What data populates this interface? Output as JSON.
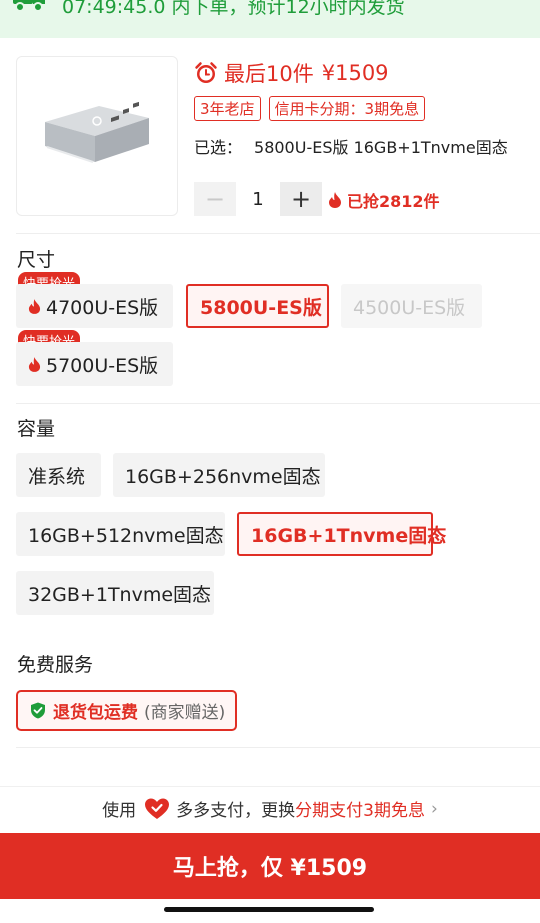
{
  "banner": {
    "text": "07:49:45.0 内下单，预计12小时内发货",
    "icon": "delivery-truck-icon",
    "color": "#1f9d3a"
  },
  "product": {
    "image": "mini-pc-product-image",
    "stock_text": "最后10件",
    "price": "¥1509",
    "tags": [
      "3年老店",
      "信用卡分期：3期免息"
    ],
    "selected_label": "已选：",
    "selected_value": "5800U-ES版 16GB+1Tnvme固态",
    "quantity": "1",
    "minus": "−",
    "plus": "+",
    "grabbed": "已抢2812件"
  },
  "size": {
    "title": "尺寸",
    "hot_badge": "快要抢光",
    "options": [
      {
        "label": "4700U-ES版",
        "state": "hot"
      },
      {
        "label": "5800U-ES版",
        "state": "selected"
      },
      {
        "label": "4500U-ES版",
        "state": "disabled"
      },
      {
        "label": "5700U-ES版",
        "state": "hot"
      }
    ]
  },
  "capacity": {
    "title": "容量",
    "options": [
      {
        "label": "准系统",
        "state": "normal"
      },
      {
        "label": "16GB+256nvme固态",
        "state": "normal"
      },
      {
        "label": "16GB+512nvme固态",
        "state": "normal"
      },
      {
        "label": "16GB+1Tnvme固态",
        "state": "selected"
      },
      {
        "label": "32GB+1Tnvme固态",
        "state": "normal"
      }
    ]
  },
  "service": {
    "title": "免费服务",
    "name": "退货包运费",
    "note": "(商家赠送)",
    "icon": "shield-check-icon"
  },
  "payment": {
    "prefix": "使用",
    "brand": "多多支付，更换",
    "highlight": "分期支付3期免息",
    "chevron": "›"
  },
  "buy_button": "马上抢，仅 ¥1509",
  "colors": {
    "accent": "#e02e24",
    "green": "#1f9d3a"
  }
}
